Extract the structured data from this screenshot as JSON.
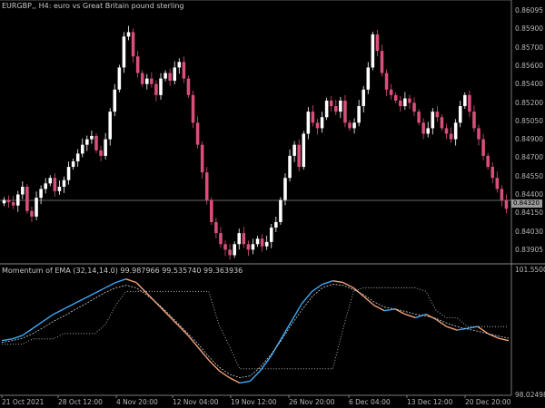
{
  "main_title": "EURGBP,, H4:  euro vs Great Britain pound sterling",
  "indicator_title": "Momentum of EMA (32,14,14.0) 99.987966 99.535740 99.363936",
  "price_ticks": [
    "0.86095",
    "0.85900",
    "0.85700",
    "0.85600",
    "0.85400",
    "0.85200",
    "0.85050",
    "0.84900",
    "0.84700",
    "0.84550",
    "0.84400",
    "0.84150",
    "0.84030",
    "0.83905"
  ],
  "current_price": "0.84320",
  "current_price_line": "0.84270",
  "indicator_ticks": [
    "101.550099",
    "98.024981"
  ],
  "time_ticks": [
    "21 Oct 2021",
    "28 Oct 12:00",
    "4 Nov 20:00",
    "12 Nov 04:00",
    "19 Nov 12:00",
    "26 Nov 20:00",
    "6 Dec 04:00",
    "13 Dec 12:00",
    "20 Dec 20:00"
  ],
  "colors": {
    "background": "#000000",
    "candle_up": "#ffffff",
    "candle_down": "#d94f7a",
    "momentum_up": "#3ea9f5",
    "momentum_down": "#f4a27a",
    "signal": "#cfcfcf",
    "grid": "#6a6a6a"
  },
  "chart_data": [
    {
      "type": "candlestick",
      "title": "EURGBP,, H4:  euro vs Great Britain pound sterling",
      "ylim": [
        0.8383,
        0.8617
      ],
      "close": [
        0.844,
        0.8438,
        0.8435,
        0.8445,
        0.8452,
        0.843,
        0.8425,
        0.8442,
        0.845,
        0.8455,
        0.846,
        0.8448,
        0.8452,
        0.8458,
        0.847,
        0.8475,
        0.8482,
        0.849,
        0.8495,
        0.8498,
        0.8485,
        0.848,
        0.8495,
        0.852,
        0.854,
        0.856,
        0.8588,
        0.8592,
        0.857,
        0.8555,
        0.8545,
        0.855,
        0.8545,
        0.8535,
        0.855,
        0.8555,
        0.8548,
        0.856,
        0.8565,
        0.855,
        0.8535,
        0.851,
        0.849,
        0.8465,
        0.844,
        0.842,
        0.841,
        0.84,
        0.8395,
        0.839,
        0.84,
        0.841,
        0.84,
        0.8395,
        0.84,
        0.8405,
        0.8398,
        0.8402,
        0.8415,
        0.842,
        0.844,
        0.846,
        0.848,
        0.849,
        0.847,
        0.85,
        0.852,
        0.851,
        0.8505,
        0.8515,
        0.853,
        0.8525,
        0.852,
        0.853,
        0.851,
        0.8505,
        0.851,
        0.8525,
        0.854,
        0.856,
        0.859,
        0.8575,
        0.8555,
        0.854,
        0.8535,
        0.853,
        0.8525,
        0.8532,
        0.8528,
        0.852,
        0.851,
        0.85,
        0.8505,
        0.852,
        0.8515,
        0.8505,
        0.85,
        0.8495,
        0.851,
        0.8525,
        0.8535,
        0.852,
        0.8505,
        0.8495,
        0.848,
        0.847,
        0.846,
        0.845,
        0.844,
        0.8432
      ]
    },
    {
      "type": "line",
      "title": "Momentum of EMA (32,14,14.0)",
      "ylim": [
        98.024981,
        101.550099
      ],
      "series": [
        {
          "values": [
            99.55,
            99.6,
            99.7,
            99.9,
            100.1,
            100.3,
            100.45,
            100.6,
            100.75,
            100.9,
            101.05,
            101.2,
            101.3,
            101.2,
            100.9,
            100.6,
            100.3,
            100.0,
            99.7,
            99.35,
            99.0,
            98.7,
            98.5,
            98.35,
            98.4,
            98.7,
            99.1,
            99.6,
            100.1,
            100.6,
            100.95,
            101.15,
            101.25,
            101.2,
            101.05,
            100.8,
            100.55,
            100.4,
            100.45,
            100.3,
            100.2,
            100.3,
            100.15,
            99.95,
            99.85,
            99.9,
            99.95,
            99.75,
            99.62,
            99.55
          ]
        },
        {
          "values": [
            99.5,
            99.55,
            99.62,
            99.75,
            99.92,
            100.1,
            100.25,
            100.42,
            100.58,
            100.75,
            100.92,
            101.05,
            101.12,
            101.05,
            100.85,
            100.62,
            100.35,
            100.05,
            99.75,
            99.45,
            99.1,
            98.8,
            98.6,
            98.5,
            98.55,
            98.8,
            99.15,
            99.55,
            100.0,
            100.42,
            100.8,
            101.05,
            101.15,
            101.12,
            101.0,
            100.85,
            100.65,
            100.5,
            100.45,
            100.38,
            100.3,
            100.25,
            100.18,
            100.05,
            99.95,
            99.88,
            99.82,
            99.75,
            99.68,
            99.62
          ]
        },
        {
          "values": [
            99.45,
            99.45,
            99.45,
            99.6,
            99.6,
            99.6,
            99.75,
            99.75,
            99.75,
            99.75,
            100.0,
            100.55,
            100.95,
            100.95,
            100.95,
            100.95,
            100.95,
            100.95,
            100.95,
            100.95,
            100.95,
            100.0,
            99.4,
            98.75,
            98.75,
            98.75,
            98.75,
            98.75,
            98.75,
            98.75,
            98.75,
            98.75,
            98.75,
            99.9,
            100.95,
            101.05,
            101.05,
            101.05,
            101.05,
            101.05,
            101.05,
            100.95,
            100.4,
            100.2,
            100.2,
            99.95,
            99.95,
            99.95,
            99.95,
            99.95
          ]
        }
      ]
    }
  ]
}
